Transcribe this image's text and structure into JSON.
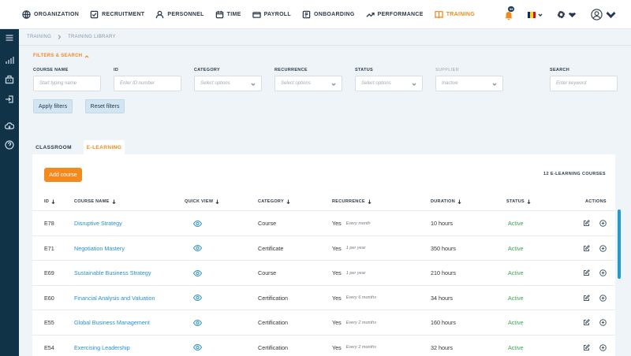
{
  "nav": {
    "items": [
      {
        "label": "ORGANIZATION",
        "icon": "globe-icon",
        "active": false
      },
      {
        "label": "RECRUITMENT",
        "icon": "checklist-icon",
        "active": false
      },
      {
        "label": "PERSONNEL",
        "icon": "person-icon",
        "active": false
      },
      {
        "label": "TIME",
        "icon": "calendar-icon",
        "active": false
      },
      {
        "label": "PAYROLL",
        "icon": "wallet-icon",
        "active": false
      },
      {
        "label": "ONBOARDING",
        "icon": "onboarding-icon",
        "active": false
      },
      {
        "label": "PERFORMANCE",
        "icon": "trend-icon",
        "active": false
      },
      {
        "label": "TRAINING",
        "icon": "book-icon",
        "active": true
      }
    ],
    "notification_count": "99",
    "accent": "#f28a1e"
  },
  "breadcrumb": [
    "TRAINING",
    "TRAINING LIBRARY"
  ],
  "filters": {
    "title": "FILTERS & SEARCH",
    "fields": [
      {
        "label": "COURSE NAME",
        "placeholder": "Start typing name"
      },
      {
        "label": "ID",
        "placeholder": "Enter ID number"
      },
      {
        "label": "CATEGORY",
        "placeholder": "Select options"
      },
      {
        "label": "RECURRENCE",
        "placeholder": "Select options"
      },
      {
        "label": "STATUS",
        "placeholder": "Select options"
      },
      {
        "label": "SUPPLIER",
        "placeholder": "Inactive"
      },
      {
        "label": "SEARCH",
        "placeholder": "Enter keyword"
      }
    ],
    "apply_label": "Apply filters",
    "reset_label": "Reset filters"
  },
  "tabs": [
    {
      "label": "CLASSROOM",
      "active": false
    },
    {
      "label": "E-LEARNING",
      "active": true
    }
  ],
  "panel": {
    "add_label": "Add course",
    "count_label": "12 E-LEARNING COURSES"
  },
  "table": {
    "headers": {
      "id": "ID",
      "name": "COURSE NAME",
      "quickview": "QUICK VIEW",
      "category": "CATEGORY",
      "recurrence": "RECURRENCE",
      "duration": "DURATION",
      "status": "STATUS",
      "actions": "ACTIONS"
    },
    "rows": [
      {
        "id": "E78",
        "name": "Disruptive Strategy",
        "category": "Course",
        "rec": "Yes",
        "rec_note": "Every month",
        "duration": "10 hours",
        "status": "Active"
      },
      {
        "id": "E71",
        "name": "Negotiation Mastery",
        "category": "Certificate",
        "rec": "Yes",
        "rec_note": "1 per year",
        "duration": "350 hours",
        "status": "Active"
      },
      {
        "id": "E69",
        "name": "Sustainable Business Strategy",
        "category": "Course",
        "rec": "Yes",
        "rec_note": "1 per year",
        "duration": "210 hours",
        "status": "Active"
      },
      {
        "id": "E60",
        "name": "Financial Analysis and Valuation",
        "category": "Certification",
        "rec": "Yes",
        "rec_note": "Every 6 months",
        "duration": "34 hours",
        "status": "Active"
      },
      {
        "id": "E55",
        "name": "Global Business Management",
        "category": "Certification",
        "rec": "Yes",
        "rec_note": "Every 2 months",
        "duration": "160 hours",
        "status": "Active"
      },
      {
        "id": "E54",
        "name": "Exercising Leadership",
        "category": "Certification",
        "rec": "Yes",
        "rec_note": "Every 2 months",
        "duration": "32 hours",
        "status": "Active"
      }
    ]
  }
}
